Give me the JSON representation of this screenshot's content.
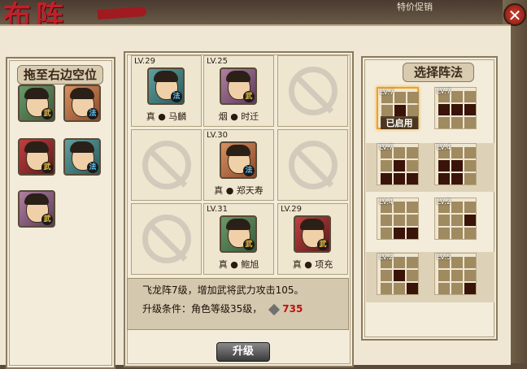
{
  "header": {
    "title_art": "布阵",
    "promo": "特价促销"
  },
  "left_panel": {
    "title": "拖至右边空位",
    "reserve": [
      {
        "type": "武",
        "color": "green"
      },
      {
        "type": "法",
        "color": "orange"
      },
      {
        "type": "武",
        "color": "red"
      },
      {
        "type": "法",
        "color": "teal"
      },
      {
        "type": "武",
        "color": "purple"
      }
    ]
  },
  "grid": {
    "cells": [
      {
        "level": "LV.29",
        "name": "真 ● 马麟",
        "type": "法",
        "color": "teal",
        "empty": false
      },
      {
        "level": "LV.25",
        "name": "烟 ● 时迁",
        "type": "武",
        "color": "purple",
        "empty": false
      },
      {
        "empty": true
      },
      {
        "empty": true
      },
      {
        "level": "LV.30",
        "name": "真 ● 郑天寿",
        "type": "法",
        "color": "orange",
        "empty": false
      },
      {
        "empty": true
      },
      {
        "empty": true
      },
      {
        "level": "LV.31",
        "name": "真 ● 鲍旭",
        "type": "武",
        "color": "green",
        "empty": false
      },
      {
        "level": "LV.29",
        "name": "真 ● 项充",
        "type": "武",
        "color": "red",
        "empty": false
      }
    ]
  },
  "info": {
    "line1": "飞龙阵7级，增加武将武力攻击105。",
    "line2_label": "升级条件：角色等级35级，",
    "cost": "735"
  },
  "upgrade_button": "升级",
  "right_panel": {
    "title": "选择阵法",
    "in_use_label": "已启用",
    "formations": [
      {
        "level": "LV.7",
        "active": true,
        "pattern": [
          0,
          0,
          0,
          0,
          1,
          0,
          0,
          0,
          0
        ]
      },
      {
        "level": "LV.7",
        "active": false,
        "pattern": [
          0,
          0,
          0,
          1,
          1,
          1,
          0,
          0,
          0
        ]
      },
      {
        "level": "LV.7",
        "active": false,
        "pattern": [
          0,
          0,
          0,
          0,
          1,
          0,
          1,
          1,
          1
        ]
      },
      {
        "level": "LV.4",
        "active": false,
        "pattern": [
          0,
          0,
          0,
          1,
          1,
          0,
          1,
          1,
          0
        ]
      },
      {
        "level": "LV.4",
        "active": false,
        "pattern": [
          0,
          0,
          0,
          0,
          0,
          0,
          0,
          1,
          1
        ]
      },
      {
        "level": "LV.2",
        "active": false,
        "pattern": [
          0,
          0,
          0,
          0,
          0,
          1,
          0,
          0,
          0
        ]
      },
      {
        "level": "LV.2",
        "active": false,
        "pattern": [
          0,
          0,
          0,
          0,
          1,
          0,
          0,
          0,
          1
        ]
      },
      {
        "level": "LV.5",
        "active": false,
        "pattern": [
          0,
          0,
          0,
          0,
          0,
          0,
          0,
          0,
          1
        ]
      }
    ]
  }
}
